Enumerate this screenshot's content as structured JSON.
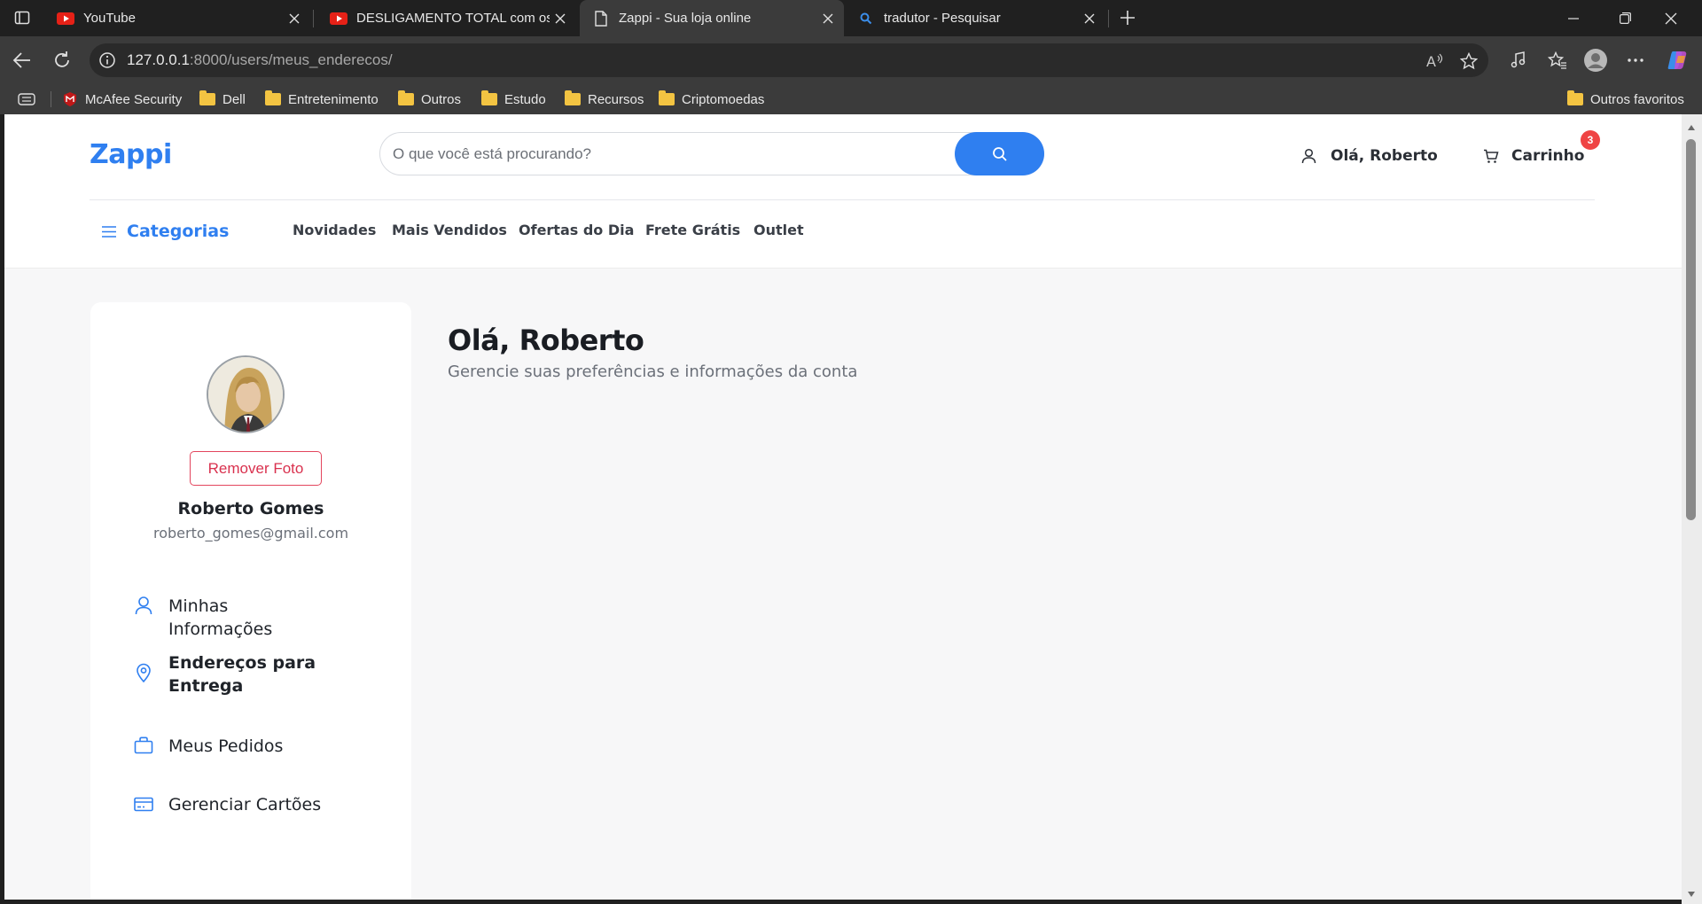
{
  "browser": {
    "tabs": [
      {
        "title": "YouTube",
        "icon": "youtube-icon"
      },
      {
        "title": "DESLIGAMENTO TOTAL com os ESTADOS",
        "icon": "youtube-icon"
      },
      {
        "title": "Zappi - Sua loja online",
        "icon": "document-icon",
        "active": true
      },
      {
        "title": "tradutor - Pesquisar",
        "icon": "search-icon"
      }
    ],
    "url_host": "127.0.0.1",
    "url_path": ":8000/users/meus_enderecos/",
    "bookmarks": [
      {
        "label": "McAfee Security",
        "icon": "mcafee-icon"
      },
      {
        "label": "Dell",
        "icon": "folder-icon"
      },
      {
        "label": "Entretenimento",
        "icon": "folder-icon"
      },
      {
        "label": "Outros",
        "icon": "folder-icon"
      },
      {
        "label": "Estudo",
        "icon": "folder-icon"
      },
      {
        "label": "Recursos",
        "icon": "folder-icon"
      },
      {
        "label": "Criptomoedas",
        "icon": "folder-icon"
      }
    ],
    "other_favorites": "Outros favoritos"
  },
  "site": {
    "logo": "Zappi",
    "search_placeholder": "O que você está procurando?",
    "user_greeting": "Olá, Roberto",
    "cart_label": "Carrinho",
    "cart_count": "3",
    "categories_label": "Categorias",
    "nav": [
      "Novidades",
      "Mais Vendidos",
      "Ofertas do Dia",
      "Frete Grátis",
      "Outlet"
    ],
    "accent_color": "#2f7ff0"
  },
  "profile": {
    "remove_photo_label": "Remover Foto",
    "name": "Roberto Gomes",
    "email": "roberto_gomes@gmail.com",
    "menu": [
      {
        "label": "Minhas Informações",
        "icon": "user-icon"
      },
      {
        "label": "Endereços para Entrega",
        "icon": "map-pin-icon",
        "active": true
      },
      {
        "label": "Meus Pedidos",
        "icon": "shopping-bag-icon"
      },
      {
        "label": "Gerenciar Cartões",
        "icon": "credit-card-icon"
      }
    ]
  },
  "main": {
    "title": "Olá, Roberto",
    "subtitle": "Gerencie suas preferências e informações da conta"
  }
}
